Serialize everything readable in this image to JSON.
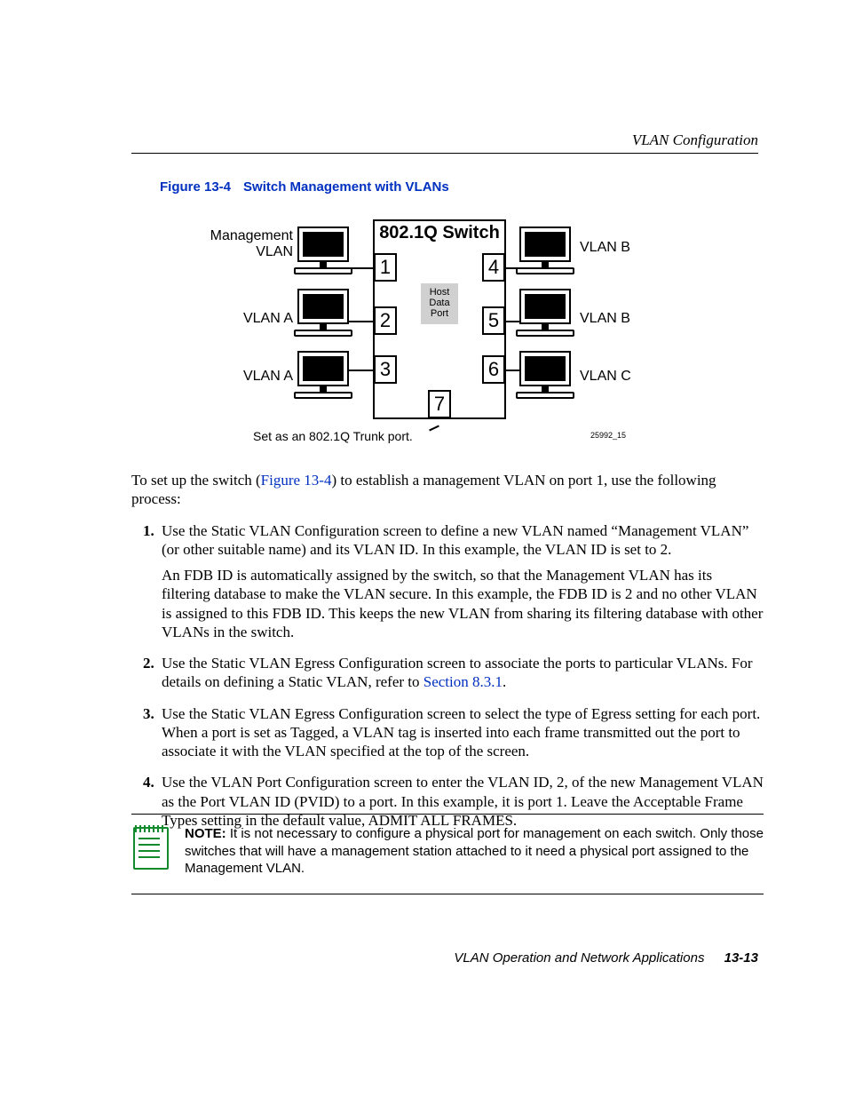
{
  "header": {
    "section_title": "VLAN Configuration"
  },
  "figure": {
    "number": "Figure 13-4",
    "title": "Switch Management with VLANs",
    "switch_title": "802.1Q Switch",
    "ports": {
      "p1": "1",
      "p2": "2",
      "p3": "3",
      "p4": "4",
      "p5": "5",
      "p6": "6",
      "p7": "7"
    },
    "hostbox_l1": "Host",
    "hostbox_l2": "Data",
    "hostbox_l3": "Port",
    "labels": {
      "left1a": "Management",
      "left1b": "VLAN",
      "left2": "VLAN A",
      "left3": "VLAN A",
      "right1": "VLAN B",
      "right2": "VLAN B",
      "right3": "VLAN C"
    },
    "trunk_note": "Set as an 802.1Q Trunk port.",
    "image_id": "25992_15"
  },
  "intro": {
    "pre": "To set up the switch (",
    "link": "Figure 13-4",
    "post": ") to establish a management VLAN on port 1, use the following process:"
  },
  "steps": [
    {
      "text": "Use the Static VLAN Configuration screen to define a new VLAN named “Management VLAN” (or other suitable name) and its VLAN ID. In this example, the VLAN ID is set to 2.",
      "extra": "An FDB ID is automatically assigned by the switch, so that the Management VLAN has its filtering database to make the VLAN secure. In this example, the FDB ID is 2 and no other VLAN is assigned to this FDB ID. This keeps the new VLAN from sharing its filtering database with other VLANs in the switch."
    },
    {
      "text_pre": "Use the Static VLAN Egress Configuration screen to associate the ports to particular VLANs. For details on defining a Static VLAN, refer to ",
      "link": "Section 8.3.1",
      "text_post": "."
    },
    {
      "text": "Use the Static VLAN Egress Configuration screen to select the type of Egress setting for each port. When a port is set as Tagged, a VLAN tag is inserted into each frame transmitted out the port to associate it with the VLAN specified at the top of the screen."
    },
    {
      "text": "Use the VLAN Port Configuration screen to enter the VLAN ID, 2, of the new Management VLAN as the Port VLAN ID (PVID) to a port. In this example, it is port 1. Leave the Acceptable Frame Types setting in the default value, ADMIT ALL FRAMES."
    }
  ],
  "note": {
    "label": "NOTE:",
    "text": "It is not necessary to configure a physical port for management on each switch. Only those switches that will have a management station attached to it need a physical port assigned to the Management VLAN."
  },
  "footer": {
    "doc_title": "VLAN Operation and Network Applications",
    "page_number": "13-13"
  }
}
